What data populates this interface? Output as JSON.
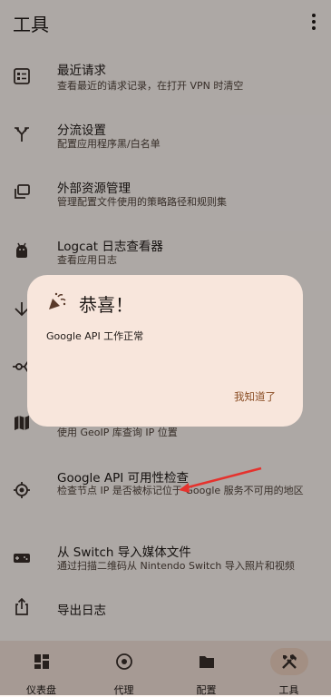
{
  "appbar": {
    "title": "工具",
    "menu_icon": "more-vert-icon"
  },
  "tools": [
    {
      "icon": "request-list-icon",
      "title": "最近请求",
      "subtitle": "查看最近的请求记录，在打开 VPN 时清空"
    },
    {
      "icon": "split-route-icon",
      "title": "分流设置",
      "subtitle": "配置应用程序黑/白名单"
    },
    {
      "icon": "library-icon",
      "title": "外部资源管理",
      "subtitle": "管理配置文件使用的策略路径和规则集"
    },
    {
      "icon": "android-icon",
      "title": "Logcat 日志查看器",
      "subtitle": "查看应用日志"
    },
    {
      "icon": "download-icon",
      "title": "",
      "subtitle": ""
    },
    {
      "icon": "network-icon",
      "title": "",
      "subtitle": ""
    },
    {
      "icon": "map-icon",
      "title": "",
      "subtitle": "使用 GeoIP 库查询 IP 位置"
    },
    {
      "icon": "gps-target-icon",
      "title": "Google API 可用性检查",
      "subtitle": "检查节点 IP 是否被标记位于 Google 服务不可用的地区"
    },
    {
      "icon": "gamepad-icon",
      "title": "从 Switch 导入媒体文件",
      "subtitle": "通过扫描二维码从 Nintendo Switch 导入照片和视频"
    },
    {
      "icon": "share-export-icon",
      "title": "导出日志",
      "subtitle": ""
    }
  ],
  "dialog": {
    "icon": "party-popper-icon",
    "title": "恭喜！",
    "message": "Google API 工作正常",
    "confirm_label": "我知道了"
  },
  "annotation": {
    "arrow_color": "#e5322d"
  },
  "nav": [
    {
      "icon": "dashboard-icon",
      "label": "仪表盘",
      "active": false
    },
    {
      "icon": "proxy-icon",
      "label": "代理",
      "active": false
    },
    {
      "icon": "folder-icon",
      "label": "配置",
      "active": false
    },
    {
      "icon": "tools-icon",
      "label": "工具",
      "active": true
    }
  ],
  "colors": {
    "background": "#fff8f4",
    "dialog": "#f8e6dc",
    "accent": "#8b4f26",
    "nav_active": "#f1d3c2"
  }
}
